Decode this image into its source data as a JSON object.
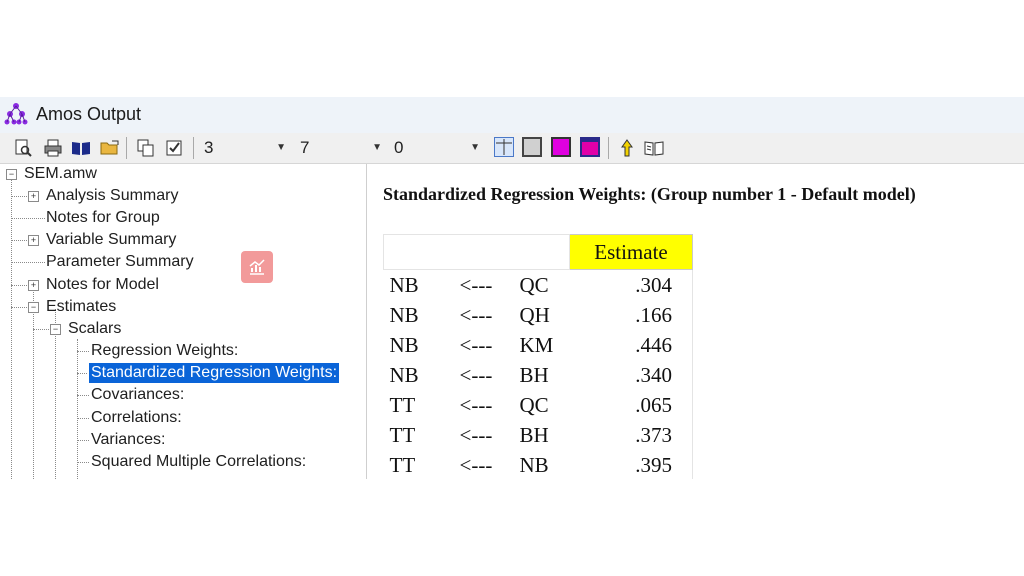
{
  "window": {
    "title": "Amos Output"
  },
  "toolbar": {
    "buttons": [
      "print-preview-icon",
      "print-icon",
      "open-book-icon",
      "open-folder-icon",
      "copy-icon",
      "checkbox-icon"
    ],
    "combos": [
      {
        "value": "3"
      },
      {
        "value": "7"
      },
      {
        "value": "0"
      }
    ],
    "colors": {
      "magenta": "#e000e0",
      "pink": "#e000a8",
      "navy": "#2a2a8a"
    }
  },
  "tree": {
    "root": "SEM.amw",
    "items": [
      {
        "label": "Analysis Summary"
      },
      {
        "label": "Notes for Group"
      },
      {
        "label": "Variable Summary"
      },
      {
        "label": "Parameter Summary"
      },
      {
        "label": "Notes for Model"
      },
      {
        "label": "Estimates"
      },
      {
        "label": "Scalars"
      },
      {
        "label": "Regression Weights:"
      },
      {
        "label": "Standardized Regression Weights:"
      },
      {
        "label": "Covariances:"
      },
      {
        "label": "Correlations:"
      },
      {
        "label": "Variances:"
      },
      {
        "label": "Squared Multiple Correlations:"
      }
    ],
    "selected_color": "#0a64d8"
  },
  "output": {
    "heading": "Standardized Regression Weights: (Group number 1 - Default model)",
    "column_header": "Estimate",
    "header_color": "#ffff00",
    "rows": [
      {
        "lhs": "NB",
        "arrow": "<---",
        "rhs": "QC",
        "estimate": ".304"
      },
      {
        "lhs": "NB",
        "arrow": "<---",
        "rhs": "QH",
        "estimate": ".166"
      },
      {
        "lhs": "NB",
        "arrow": "<---",
        "rhs": "KM",
        "estimate": ".446"
      },
      {
        "lhs": "NB",
        "arrow": "<---",
        "rhs": "BH",
        "estimate": ".340"
      },
      {
        "lhs": "TT",
        "arrow": "<---",
        "rhs": "QC",
        "estimate": ".065"
      },
      {
        "lhs": "TT",
        "arrow": "<---",
        "rhs": "BH",
        "estimate": ".373"
      },
      {
        "lhs": "TT",
        "arrow": "<---",
        "rhs": "NB",
        "estimate": ".395"
      }
    ]
  }
}
